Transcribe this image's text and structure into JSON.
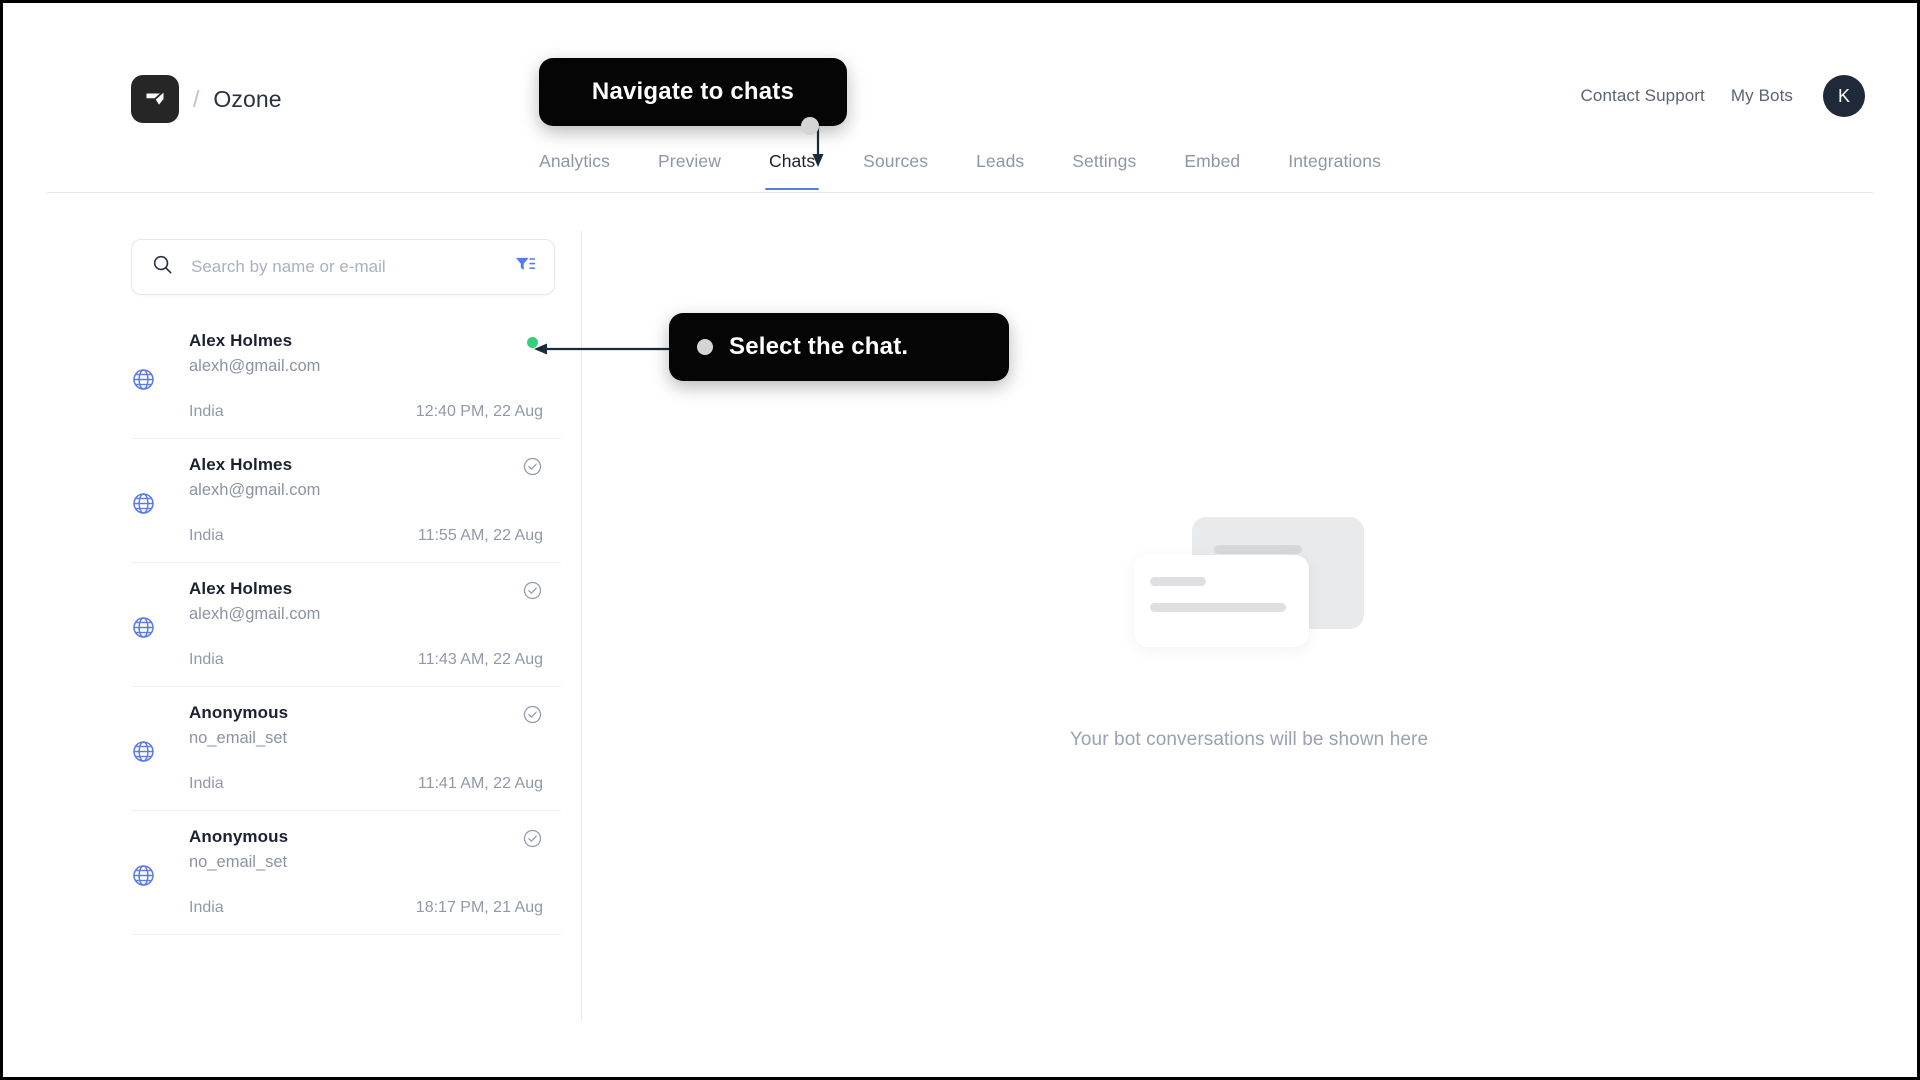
{
  "header": {
    "brand_separator": "/",
    "brand_name": "Ozone",
    "logo_icon": "ozone-logo-icon",
    "links": [
      {
        "label": "Contact Support",
        "name": "contact-support-link"
      },
      {
        "label": "My Bots",
        "name": "my-bots-link"
      }
    ],
    "avatar_initial": "K"
  },
  "nav": {
    "tabs": [
      {
        "label": "Analytics",
        "active": false
      },
      {
        "label": "Preview",
        "active": false
      },
      {
        "label": "Chats",
        "active": true
      },
      {
        "label": "Sources",
        "active": false
      },
      {
        "label": "Leads",
        "active": false
      },
      {
        "label": "Settings",
        "active": false
      },
      {
        "label": "Embed",
        "active": false
      },
      {
        "label": "Integrations",
        "active": false
      }
    ],
    "active_accent": "#4f7fe8"
  },
  "search": {
    "placeholder": "Search by name or e-mail",
    "value": "",
    "search_icon": "search-icon",
    "filter_icon": "filter-icon",
    "filter_icon_color": "#4f7fe8"
  },
  "chat_list": [
    {
      "name": "Alex Holmes",
      "email": "alexh@gmail.com",
      "country": "India",
      "time": "12:40 PM, 22 Aug",
      "status": "live",
      "status_icon": "green-dot-icon",
      "status_color": "#31d07a",
      "channel_icon": "globe-icon"
    },
    {
      "name": "Alex Holmes",
      "email": "alexh@gmail.com",
      "country": "India",
      "time": "11:55 AM, 22 Aug",
      "status": "resolved",
      "status_icon": "check-circle-icon",
      "status_color": "#9199a8",
      "channel_icon": "globe-icon"
    },
    {
      "name": "Alex Holmes",
      "email": "alexh@gmail.com",
      "country": "India",
      "time": "11:43 AM, 22 Aug",
      "status": "resolved",
      "status_icon": "check-circle-icon",
      "status_color": "#9199a8",
      "channel_icon": "globe-icon"
    },
    {
      "name": "Anonymous",
      "email": "no_email_set",
      "country": "India",
      "time": "11:41 AM, 22 Aug",
      "status": "resolved",
      "status_icon": "check-circle-icon",
      "status_color": "#9199a8",
      "channel_icon": "globe-icon"
    },
    {
      "name": "Anonymous",
      "email": "no_email_set",
      "country": "India",
      "time": "18:17 PM, 21 Aug",
      "status": "resolved",
      "status_icon": "check-circle-icon",
      "status_color": "#9199a8",
      "channel_icon": "globe-icon"
    }
  ],
  "empty_state": {
    "text": "Your bot conversations will be shown here",
    "illustration_icon": "stacked-cards-illustration"
  },
  "callouts": [
    {
      "text": "Navigate to chats",
      "target": "Chats tab"
    },
    {
      "text": "Select the chat.",
      "target": "first chat item"
    }
  ]
}
